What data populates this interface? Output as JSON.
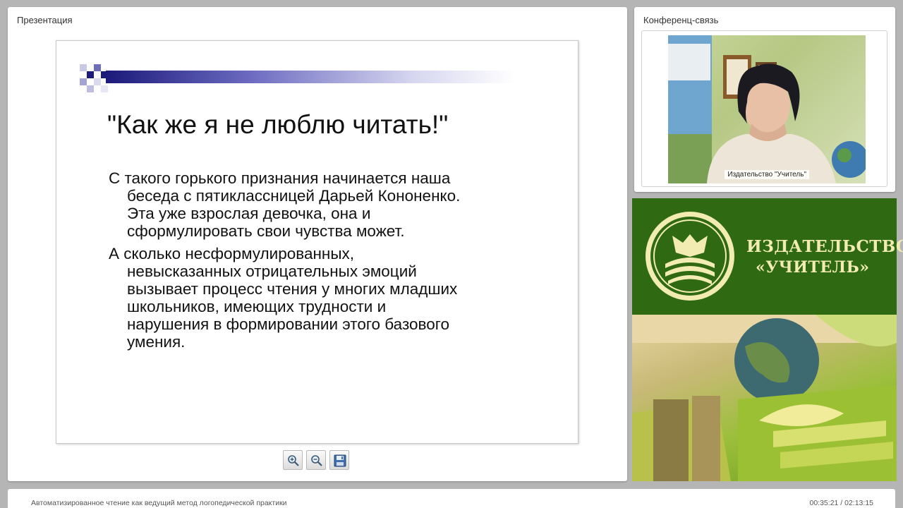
{
  "presentation_panel": {
    "title": "Презентация",
    "slide": {
      "title": "\"Как же я не люблю читать!\"",
      "paragraphs": [
        {
          "first_line": "С такого горького признания начинается наша",
          "rest_lines": [
            "беседа с пятиклассницей Дарьей Кононенко.",
            "Эта уже взрослая девочка, она и",
            "сформулировать свои чувства может."
          ]
        },
        {
          "first_line": "А сколько несформулированных,",
          "rest_lines": [
            "невысказанных отрицательных эмоций",
            "вызывает процесс чтения у многих младших",
            "школьников, имеющих трудности и",
            "нарушения в формировании этого базового",
            "умения."
          ]
        }
      ]
    },
    "toolbar": [
      {
        "name": "zoom-in",
        "icon": "zoom-in-icon"
      },
      {
        "name": "zoom-out",
        "icon": "zoom-out-icon"
      },
      {
        "name": "save",
        "icon": "floppy-disk-icon"
      }
    ]
  },
  "conference_panel": {
    "title": "Конференц-связь",
    "video_caption": "Издательство \"Учитель\""
  },
  "publisher_banner": {
    "line1": "ИЗДАТЕЛЬСТВО",
    "line2": "«УЧИТЕЛЬ»",
    "colors": {
      "background": "#2f6a12",
      "text": "#f2ecb3"
    }
  },
  "footer": {
    "title": "Автоматизированное чтение как ведущий метод логопедической практики",
    "time": "00:35:21 / 02:13:15"
  }
}
